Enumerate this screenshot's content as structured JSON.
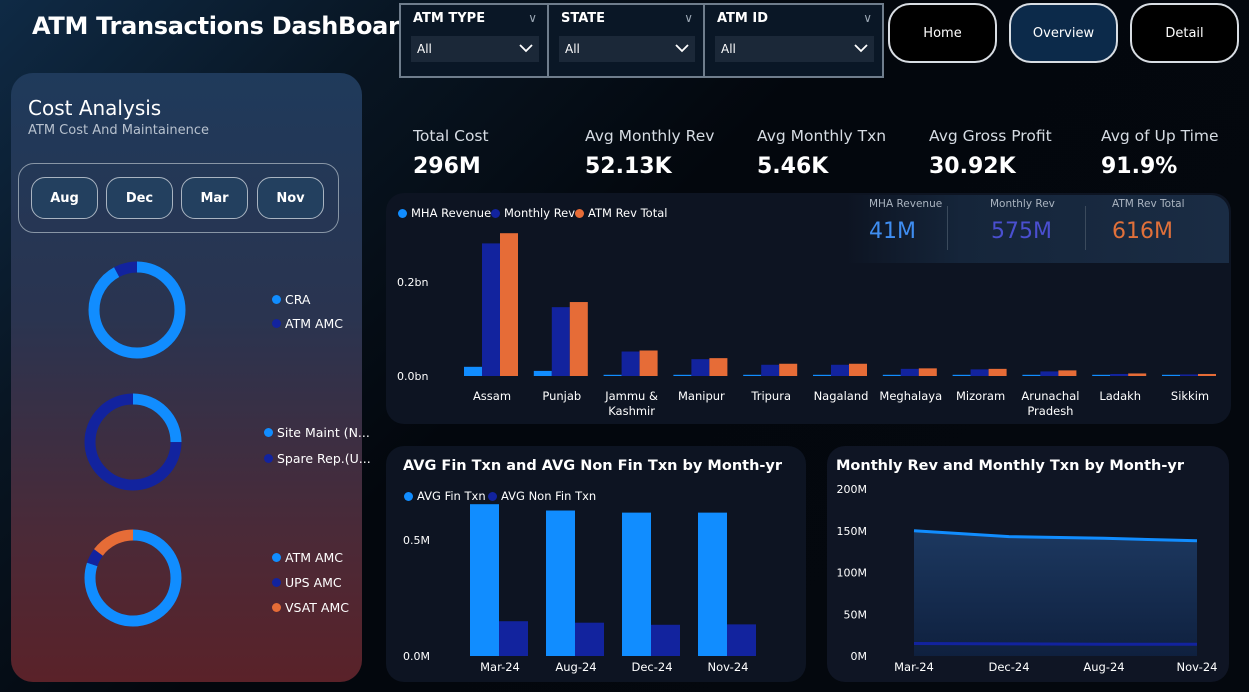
{
  "header": {
    "title": "ATM Transactions DashBoard"
  },
  "slicers": [
    {
      "label": "ATM TYPE",
      "value": "All"
    },
    {
      "label": "STATE",
      "value": "All"
    },
    {
      "label": "ATM ID",
      "value": "All"
    }
  ],
  "nav": {
    "home": "Home",
    "overview": "Overview",
    "detail": "Detail"
  },
  "cost_panel": {
    "title": "Cost Analysis",
    "subtitle": "ATM Cost And Maintainence",
    "months": [
      "Aug",
      "Dec",
      "Mar",
      "Nov"
    ]
  },
  "kpis": [
    {
      "label": "Total Cost",
      "value": "296M"
    },
    {
      "label": "Avg Monthly Rev",
      "value": "52.13K"
    },
    {
      "label": "Avg Monthly Txn",
      "value": "5.46K"
    },
    {
      "label": "Avg Gross Profit",
      "value": "30.92K"
    },
    {
      "label": "Avg of Up Time",
      "value": "91.9%"
    }
  ],
  "bar_kpis": [
    {
      "label": "MHA Revenue",
      "value": "41M",
      "color": "#3f8df0"
    },
    {
      "label": "Monthly Rev",
      "value": "575M",
      "color": "#4a4fd0"
    },
    {
      "label": "ATM Rev Total",
      "value": "616M",
      "color": "#e0703a"
    }
  ],
  "colors": {
    "light_blue": "#118dff",
    "dark_blue": "#12239e",
    "orange": "#e66c37"
  },
  "chart_data": [
    {
      "type": "donut",
      "series": [
        {
          "name": "CRA",
          "value": 0.92,
          "color": "#118dff"
        },
        {
          "name": "ATM AMC",
          "value": 0.08,
          "color": "#12239e"
        }
      ]
    },
    {
      "type": "donut",
      "series": [
        {
          "name": "Site Maint (N...",
          "value": 0.25,
          "color": "#118dff"
        },
        {
          "name": "Spare Rep.(U...",
          "value": 0.75,
          "color": "#12239e"
        }
      ]
    },
    {
      "type": "donut",
      "series": [
        {
          "name": "ATM AMC",
          "value": 0.8,
          "color": "#118dff"
        },
        {
          "name": "UPS AMC",
          "value": 0.05,
          "color": "#12239e"
        },
        {
          "name": "VSAT AMC",
          "value": 0.15,
          "color": "#e66c37"
        }
      ]
    },
    {
      "type": "bar",
      "categories": [
        "Assam",
        "Punjab",
        "Jammu & Kashmir",
        "Manipur",
        "Tripura",
        "Nagaland",
        "Meghalaya",
        "Mizoram",
        "Arunachal Pradesh",
        "Ladakh",
        "Sikkim"
      ],
      "series": [
        {
          "name": "MHA Revenue",
          "color": "#118dff",
          "values": [
            0.018,
            0.01,
            0.002,
            0.001,
            0.001,
            0.001,
            0.001,
            0.001,
            0.001,
            0.001,
            0.001
          ]
        },
        {
          "name": "Monthly Rev",
          "color": "#12239e",
          "values": [
            0.26,
            0.135,
            0.048,
            0.033,
            0.022,
            0.022,
            0.014,
            0.013,
            0.009,
            0.004,
            0.003
          ]
        },
        {
          "name": "ATM Rev Total",
          "color": "#e66c37",
          "values": [
            0.28,
            0.145,
            0.05,
            0.035,
            0.024,
            0.024,
            0.015,
            0.014,
            0.011,
            0.005,
            0.004
          ]
        }
      ],
      "yticks": [
        "0.0bn",
        "0.2bn"
      ],
      "ylim": [
        0,
        0.3
      ]
    },
    {
      "type": "bar",
      "title": "AVG Fin Txn and AVG Non Fin Txn by Month-yr",
      "categories": [
        "Mar-24",
        "Aug-24",
        "Dec-24",
        "Nov-24"
      ],
      "series": [
        {
          "name": "AVG Fin Txn",
          "color": "#118dff",
          "values": [
            0.72,
            0.69,
            0.68,
            0.68
          ]
        },
        {
          "name": "AVG Non Fin Txn",
          "color": "#12239e",
          "values": [
            0.165,
            0.158,
            0.148,
            0.15
          ]
        }
      ],
      "yticks": [
        "0.0M",
        "0.5M"
      ],
      "ylim": [
        0,
        0.83
      ]
    },
    {
      "type": "area",
      "title": "Monthly Rev and Monthly Txn by Month-yr",
      "x": [
        "Mar-24",
        "Dec-24",
        "Aug-24",
        "Nov-24"
      ],
      "series": [
        {
          "name": "Monthly Rev",
          "color": "#118dff",
          "values": [
            150,
            143,
            141,
            138
          ]
        },
        {
          "name": "Monthly Txn",
          "color": "#12239e",
          "values": [
            15,
            14.5,
            14,
            14
          ]
        }
      ],
      "yticks": [
        "0M",
        "50M",
        "100M",
        "150M",
        "200M"
      ],
      "ylim": [
        0,
        200
      ]
    }
  ]
}
